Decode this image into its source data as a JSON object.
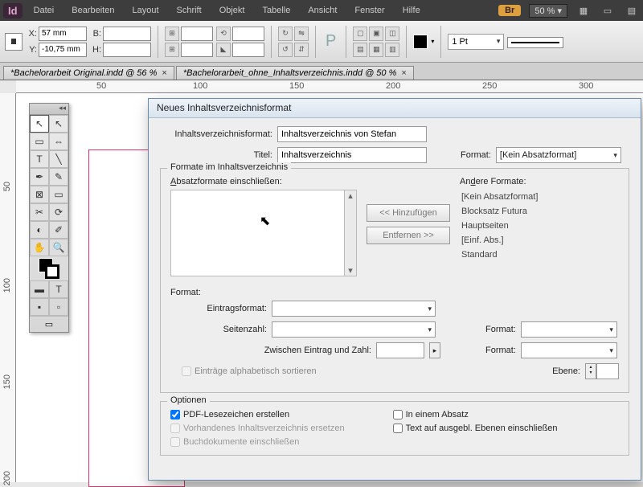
{
  "menubar": {
    "items": [
      "Datei",
      "Bearbeiten",
      "Layout",
      "Schrift",
      "Objekt",
      "Tabelle",
      "Ansicht",
      "Fenster",
      "Hilfe"
    ],
    "br": "Br",
    "zoom": "50 %"
  },
  "controlbar": {
    "x": "57 mm",
    "y": "-10,75 mm",
    "b": "",
    "h": "",
    "stroke": "1 Pt"
  },
  "tabs": [
    {
      "label": "*Bachelorarbeit Original.indd @ 56 %"
    },
    {
      "label": "*Bachelorarbeit_ohne_Inhaltsverzeichnis.indd @ 50 %"
    }
  ],
  "ruler_h": [
    "50",
    "100",
    "150",
    "200",
    "250",
    "300"
  ],
  "ruler_v": [
    "50",
    "100",
    "150",
    "200"
  ],
  "dialog": {
    "title": "Neues Inhaltsverzeichnisformat",
    "format_lbl": "Inhaltsverzeichnisformat:",
    "format_val": "Inhaltsverzeichnis von Stefan",
    "titel_lbl": "Titel:",
    "titel_val": "Inhaltsverzeichnis",
    "formatdd_lbl": "Format:",
    "formatdd_val": "[Kein Absatzformat]",
    "group1_title": "Formate im Inhaltsverzeichnis",
    "absatz_lbl": "Absatzformate einschließen:",
    "andere_lbl": "Andere Formate:",
    "andere_list": [
      "[Kein Absatzformat]",
      "Blocksatz Futura",
      "Hauptseiten",
      "[Einf. Abs.]",
      "Standard"
    ],
    "add_btn": "<< Hinzufügen",
    "rem_btn": "Entfernen >>",
    "fmt_lbl": "Format:",
    "eintragsfmt_lbl": "Eintragsformat:",
    "seitenzahl_lbl": "Seitenzahl:",
    "zwischen_lbl": "Zwischen Eintrag und Zahl:",
    "fmt2_lbl": "Format:",
    "fmt3_lbl": "Format:",
    "ebene_lbl": "Ebene:",
    "alpha_sort": "Einträge alphabetisch sortieren",
    "optionen_title": "Optionen",
    "pdf_lz": "PDF-Lesezeichen erstellen",
    "vorh_ers": "Vorhandenes Inhaltsverzeichnis ersetzen",
    "buchdok": "Buchdokumente einschließen",
    "in_absatz": "In einem Absatz",
    "ausgebl": "Text auf ausgebl. Ebenen einschließen"
  }
}
